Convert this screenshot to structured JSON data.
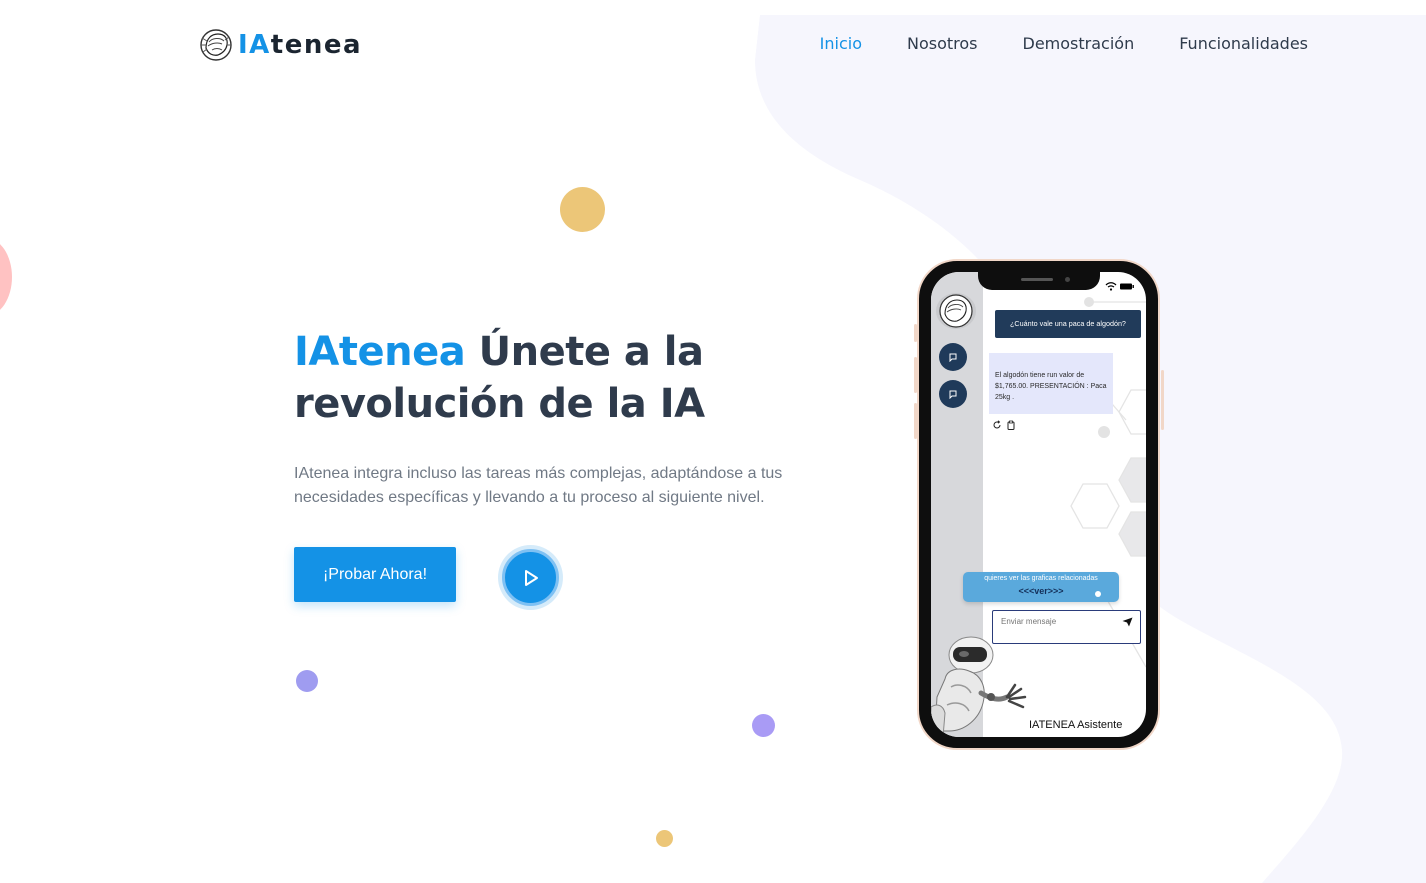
{
  "brand": {
    "name_part_accent": "IA",
    "name_part_rest": "tenea",
    "accent_color": "#1492e6"
  },
  "nav": {
    "items": [
      {
        "label": "Inicio",
        "active": true
      },
      {
        "label": "Nosotros",
        "active": false
      },
      {
        "label": "Demostración",
        "active": false
      },
      {
        "label": "Funcionalidades",
        "active": false
      }
    ]
  },
  "hero": {
    "title_brand": "IAtenea",
    "title_line1_rest": " Únete a la",
    "title_line2": "revolución de la IA",
    "description": "IAtenea integra incluso las tareas más complejas, adaptándose a tus necesidades específicas y llevando a tu proceso al siguiente nivel.",
    "cta_label": "¡Probar Ahora!",
    "play_icon": "play-icon"
  },
  "phone": {
    "user_message": "¿Cuánto vale una paca de algodón?",
    "bot_message": "El algodón tiene run valor de $1,765.00. PRESENTACIÓN : Paca 25kg .",
    "suggestion_line1": "quieres ver las graficas  relacionadas",
    "suggestion_line2": "<<<ver>>>",
    "input_placeholder": "Enviar mensaje",
    "assistant_label": "IATENEA Asistente"
  },
  "colors": {
    "primary": "#1492e6",
    "heading": "#2f3b4c",
    "body_text": "#707985",
    "background_blob": "#f6f6fd",
    "chat_dark": "#213b5a",
    "deco_gold": "#ecc678",
    "deco_purple": "#a99bf5"
  }
}
